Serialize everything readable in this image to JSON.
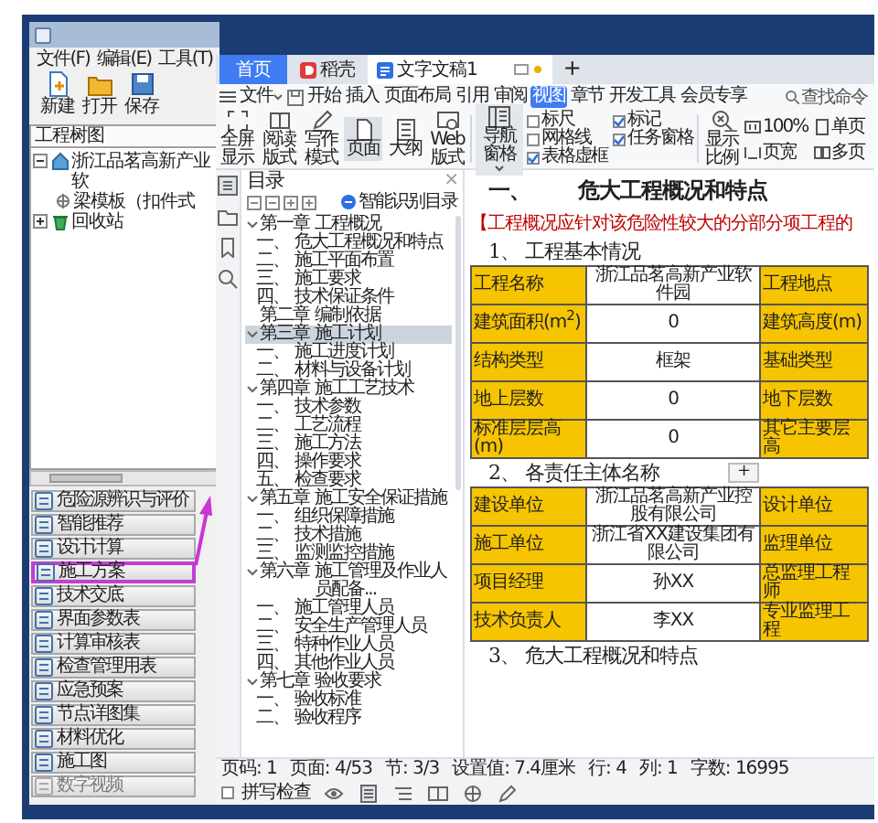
{
  "left_app": {
    "menu": [
      "文件(F)",
      "编辑(E)",
      "工具(T)"
    ],
    "toolbar": [
      "新建",
      "打开",
      "保存"
    ],
    "tree_header": "工程树图",
    "tree": [
      {
        "label": "浙江品茗高新产业软",
        "expanded": true,
        "children": [
          {
            "label": "梁模板（扣件式"
          }
        ]
      },
      {
        "label": "回收站",
        "expanded": false
      }
    ],
    "modules": [
      {
        "label": "危险源辨识与评价",
        "selected": false,
        "disabled": false
      },
      {
        "label": "智能推荐",
        "selected": false,
        "disabled": false
      },
      {
        "label": "设计计算",
        "selected": false,
        "disabled": false
      },
      {
        "label": "施工方案",
        "selected": true,
        "disabled": false
      },
      {
        "label": "技术交底",
        "selected": false,
        "disabled": false
      },
      {
        "label": "界面参数表",
        "selected": false,
        "disabled": false
      },
      {
        "label": "计算审核表",
        "selected": false,
        "disabled": false
      },
      {
        "label": "检查管理用表",
        "selected": false,
        "disabled": false
      },
      {
        "label": "应急预案",
        "selected": false,
        "disabled": false
      },
      {
        "label": "节点详图集",
        "selected": false,
        "disabled": false
      },
      {
        "label": "材料优化",
        "selected": false,
        "disabled": false
      },
      {
        "label": "施工图",
        "selected": false,
        "disabled": false
      },
      {
        "label": "数字视频",
        "selected": false,
        "disabled": true
      }
    ]
  },
  "wps": {
    "tabs": [
      {
        "label": "首页",
        "kind": "home",
        "selected": false
      },
      {
        "label": "稻壳",
        "kind": "store",
        "selected": false
      },
      {
        "label": "文字文稿1",
        "kind": "doc",
        "selected": true
      }
    ],
    "new_tab": "+",
    "file_menu": "文件",
    "ribbon_tabs": [
      {
        "label": "开始",
        "selected": false
      },
      {
        "label": "插入",
        "selected": false
      },
      {
        "label": "页面布局",
        "selected": false
      },
      {
        "label": "引用",
        "selected": false
      },
      {
        "label": "审阅",
        "selected": false
      },
      {
        "label": "视图",
        "selected": true
      },
      {
        "label": "章节",
        "selected": false
      },
      {
        "label": "开发工具",
        "selected": false
      },
      {
        "label": "会员专享",
        "selected": false
      }
    ],
    "search": {
      "placeholder": "查找命令"
    },
    "view_buttons": [
      {
        "label": "全屏显示",
        "selected": false
      },
      {
        "label": "阅读版式",
        "selected": false
      },
      {
        "label": "写作模式",
        "selected": false
      },
      {
        "label": "页面",
        "selected": true
      },
      {
        "label": "大纲",
        "selected": false
      },
      {
        "label": "Web版式",
        "selected": false
      }
    ],
    "nav_pane": "导航窗格",
    "options": [
      {
        "label": "标尺",
        "checked": false
      },
      {
        "label": "网格线",
        "checked": false
      },
      {
        "label": "表格虚框",
        "checked": true
      },
      {
        "label": "标记",
        "checked": true
      },
      {
        "label": "任务窗格",
        "checked": true
      }
    ],
    "zoom": "显示比例",
    "zoom_options": [
      "100%",
      "单页",
      "页宽",
      "多页"
    ],
    "outline": {
      "title": "目录",
      "close": "×",
      "smart_button": "智能识别目录",
      "items": [
        {
          "number": "第一章",
          "title": "工程概况",
          "expanded": true,
          "selected": false,
          "children": [
            {
              "number": "一、",
              "title": "危大工程概况和特点"
            },
            {
              "number": "二、",
              "title": "施工平面布置"
            },
            {
              "number": "三、",
              "title": "施工要求"
            },
            {
              "number": "四、",
              "title": "技术保证条件"
            }
          ]
        },
        {
          "number": "第二章",
          "title": "编制依据",
          "selected": false
        },
        {
          "number": "第三章",
          "title": "施工计划",
          "expanded": true,
          "selected": true,
          "children": [
            {
              "number": "一、",
              "title": "施工进度计划"
            },
            {
              "number": "二、",
              "title": "材料与设备计划"
            }
          ]
        },
        {
          "number": "第四章",
          "title": "施工工艺技术",
          "expanded": true,
          "selected": false,
          "children": [
            {
              "number": "一、",
              "title": "技术参数"
            },
            {
              "number": "二、",
              "title": "工艺流程"
            },
            {
              "number": "三、",
              "title": "施工方法"
            },
            {
              "number": "四、",
              "title": "操作要求"
            },
            {
              "number": "五、",
              "title": "检查要求"
            }
          ]
        },
        {
          "number": "第五章",
          "title": "施工安全保证措施",
          "expanded": true,
          "selected": false,
          "children": [
            {
              "number": "一、",
              "title": "组织保障措施"
            },
            {
              "number": "二、",
              "title": "技术措施"
            },
            {
              "number": "三、",
              "title": "监测监控措施"
            }
          ]
        },
        {
          "number": "第六章",
          "title": "施工管理及作业人员配备...",
          "expanded": true,
          "selected": false,
          "children": [
            {
              "number": "一、",
              "title": "施工管理人员"
            },
            {
              "number": "二、",
              "title": "安全生产管理人员"
            },
            {
              "number": "三、",
              "title": "特种作业人员"
            },
            {
              "number": "四、",
              "title": "其他作业人员"
            }
          ]
        },
        {
          "number": "第七章",
          "title": "验收要求",
          "expanded": true,
          "selected": false,
          "children": [
            {
              "number": "一、",
              "title": "验收标准"
            },
            {
              "number": "二、",
              "title": "验收程序"
            }
          ]
        }
      ]
    },
    "document": {
      "heading_number": "一、",
      "heading": "危大工程概况和特点",
      "note": "【工程概况应针对该危险性较大的分部分项工程的",
      "sections": [
        {
          "heading": "1、 工程基本情况",
          "rows": [
            [
              "工程名称",
              "浙江品茗高新产业软件园",
              "工程地点"
            ],
            [
              "建筑面积(m$^{2}$)",
              "0",
              "建筑高度(m)"
            ],
            [
              "结构类型",
              "框架",
              "基础类型"
            ],
            [
              "地上层数",
              "0",
              "地下层数"
            ],
            [
              "标准层层高(m)",
              "0",
              "其它主要层高"
            ]
          ]
        },
        {
          "heading": "2、 各责任主体名称",
          "rows": [
            [
              "建设单位",
              "浙江品茗高新产业控股有限公司",
              "设计单位"
            ],
            [
              "施工单位",
              "浙江省XX建设集团有限公司",
              "监理单位"
            ],
            [
              "项目经理",
              "孙XX",
              "总监理工程师"
            ],
            [
              "技术负责人",
              "李XX",
              "专业监理工程"
            ]
          ]
        },
        {
          "heading": "3、 危大工程概况和特点"
        }
      ],
      "add_row": "+"
    },
    "status_bar": [
      "页码: 1",
      "页面: 4/53",
      "节: 3/3",
      "设置值: 7.4厘米",
      "行: 4",
      "列: 1",
      "字数: 16995"
    ],
    "spell_check": {
      "label": "拼写检查",
      "checked": false
    }
  }
}
